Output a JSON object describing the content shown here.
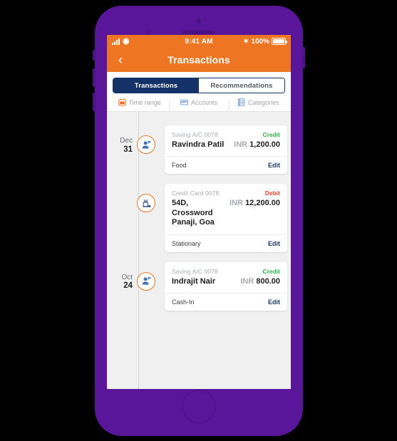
{
  "status_bar": {
    "signal_icon": "signal-bars-icon",
    "wifi_icon": "wifi-icon",
    "time": "9:41 AM",
    "bluetooth_glyph": "✶",
    "battery_percent": "100%"
  },
  "nav": {
    "back_icon": "chevron-left-icon",
    "back_glyph": "‹",
    "title": "Transactions"
  },
  "tabs": [
    {
      "label": "Transactions",
      "active": true
    },
    {
      "label": "Recommendations",
      "active": false
    }
  ],
  "filters": [
    {
      "label": "Time range",
      "icon": "calendar-icon"
    },
    {
      "label": "Accounts",
      "icon": "wallet-icon"
    },
    {
      "label": "Categories",
      "icon": "list-icon"
    }
  ],
  "transactions": [
    {
      "date_month": "Dec",
      "date_day": "31",
      "show_date": true,
      "marker_icon": "contact-person-icon",
      "account": "Saving A/C 0078",
      "type": "Credit",
      "type_kind": "credit",
      "payee": "Ravindra Patil",
      "currency": "INR",
      "amount": "1,200.00",
      "category": "Food",
      "edit_label": "Edit"
    },
    {
      "date_month": "",
      "date_day": "",
      "show_date": false,
      "marker_icon": "stationery-icon",
      "account": "Credit Card 0078",
      "type": "Debit",
      "type_kind": "debit",
      "payee": "54D,\nCrossword\nPanaji, Goa",
      "currency": "INR",
      "amount": "12,200.00",
      "category": "Stationary",
      "edit_label": "Edit"
    },
    {
      "date_month": "Oct",
      "date_day": "24",
      "show_date": true,
      "marker_icon": "contact-person-icon",
      "account": "Saving A/C 0078",
      "type": "Credit",
      "type_kind": "credit",
      "payee": "Indrajit Nair",
      "currency": "INR",
      "amount": "800.00",
      "category": "Cash-In",
      "edit_label": "Edit"
    }
  ],
  "colors": {
    "phone_body": "#59169b",
    "accent_orange": "#ee7623",
    "tab_navy": "#143168",
    "credit_green": "#2db34a",
    "debit_red": "#e8422e",
    "edit_blue": "#1b3a6b"
  }
}
